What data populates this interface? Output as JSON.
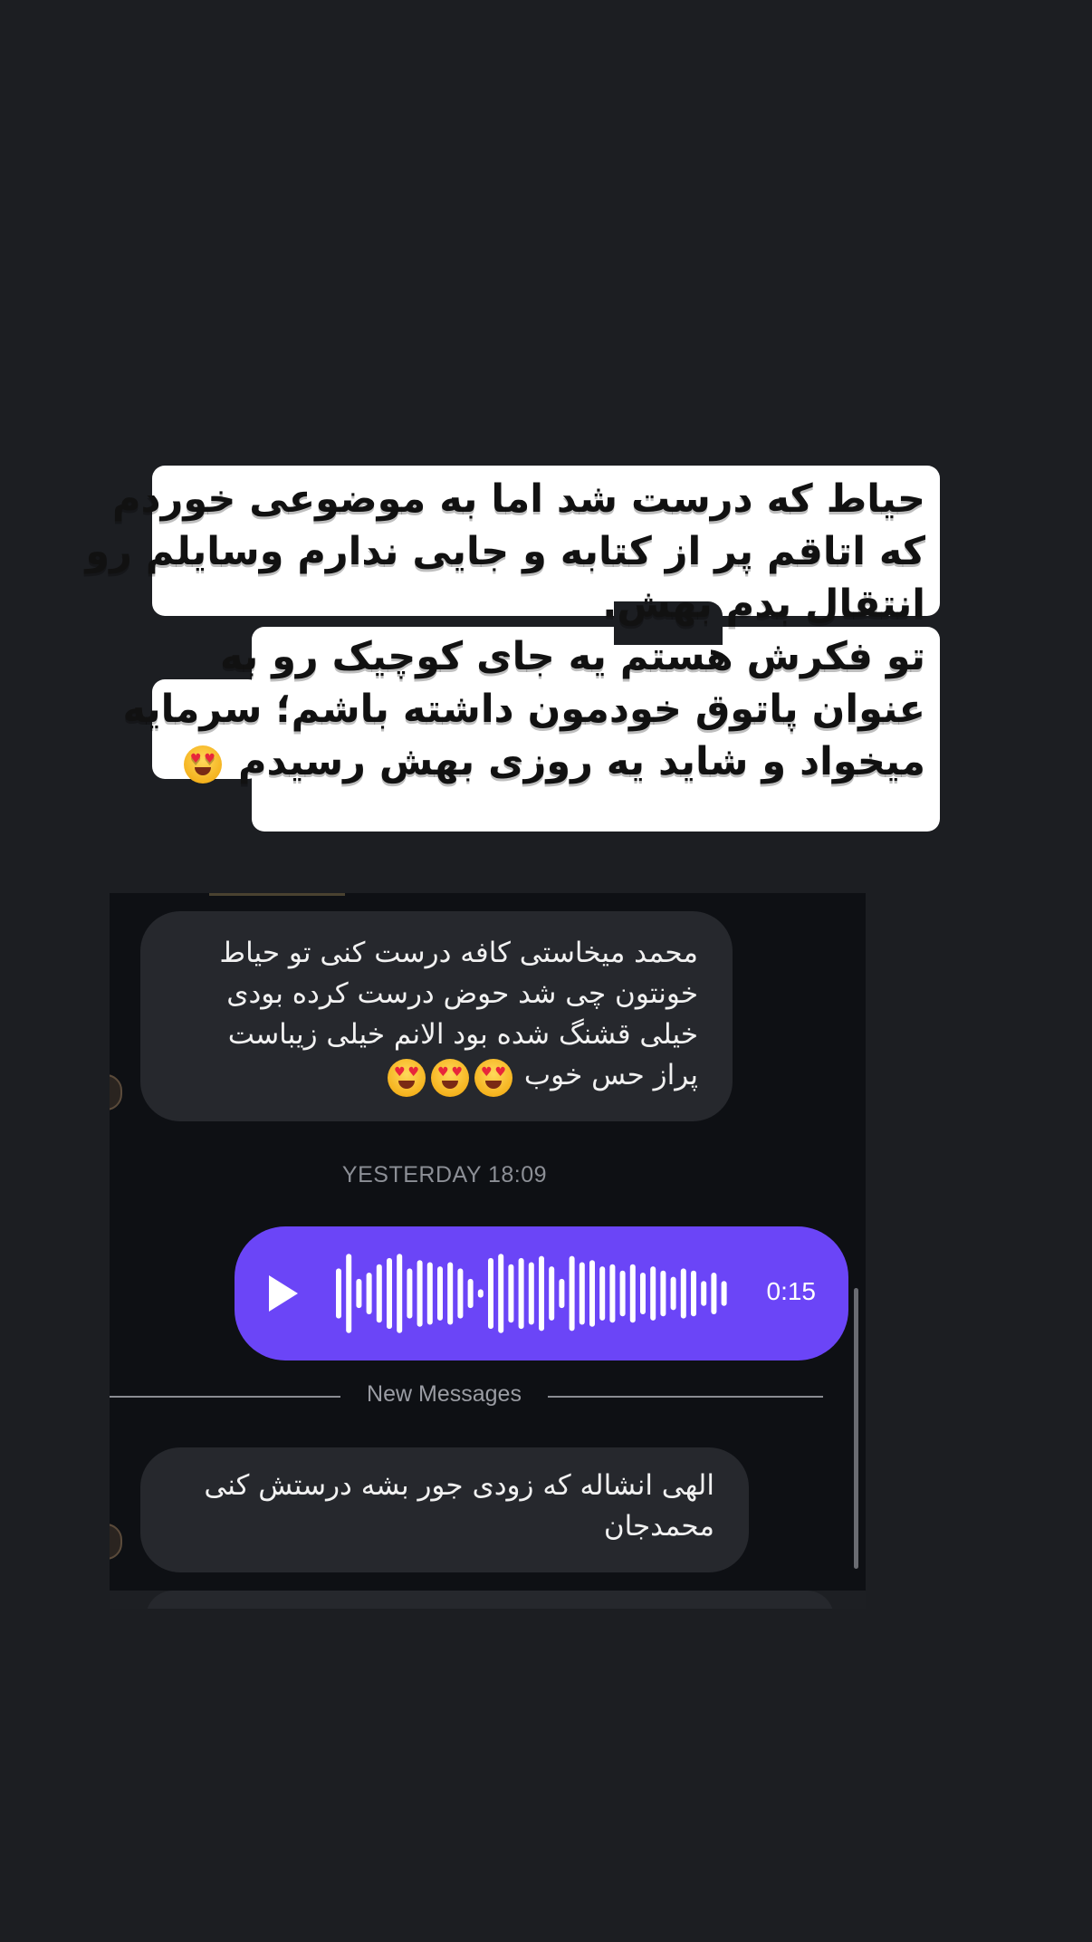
{
  "caption": {
    "lines": [
      "حیاط که درست شد اما به موضوعی خوردم",
      "که اتاقم پر از کتابه و جایی ندارم وسایلم رو",
      "انتقال بدم بهش.",
      "تو فکرش هستم یه جای کوچیک رو به",
      "عنوان پاتوق خودمون داشته باشم؛ سرمایه",
      "میخواد و شاید یه روزی بهش رسیدم"
    ],
    "emoji": "smiling-face-with-heart-eyes"
  },
  "chat": {
    "message1": {
      "lines": [
        "محمد میخاستی کافه درست کنی تو حیاط",
        "خونتون چی شد حوض درست کرده بودی",
        "خیلی قشنگ شده بود الانم خیلی زیباست",
        "پراز حس خوب"
      ],
      "emoji_count": 3
    },
    "timestamp": "YESTERDAY 18:09",
    "voice_message": {
      "duration": "0:15",
      "waveform": [
        0.6,
        0.95,
        0.35,
        0.5,
        0.7,
        0.85,
        0.95,
        0.6,
        0.8,
        0.75,
        0.65,
        0.75,
        0.6,
        0.35,
        0.1,
        0.85,
        0.95,
        0.7,
        0.85,
        0.75,
        0.9,
        0.65,
        0.35,
        0.9,
        0.75,
        0.8,
        0.65,
        0.7,
        0.55,
        0.7,
        0.5,
        0.65,
        0.55,
        0.4,
        0.6,
        0.55,
        0.3,
        0.5,
        0.3
      ]
    },
    "divider_label": "New Messages",
    "message2": {
      "lines": [
        "الهی انشاله که زودی جور بشه درستش کنی",
        "محمدجان"
      ]
    },
    "colors": {
      "voice_bubble": "#6b45f7",
      "incoming_bubble": "#26282d",
      "chat_background": "#0e1014"
    }
  }
}
